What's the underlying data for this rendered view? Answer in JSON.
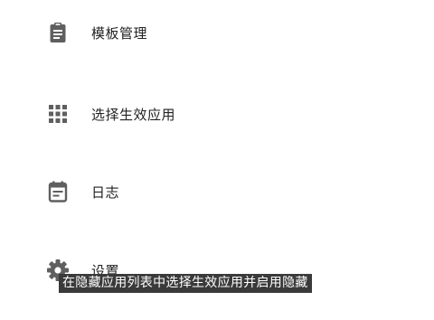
{
  "menu": {
    "items": [
      {
        "label": "模板管理",
        "icon": "clipboard-icon"
      },
      {
        "label": "选择生效应用",
        "icon": "grid-icon"
      },
      {
        "label": "日志",
        "icon": "calendar-icon"
      },
      {
        "label": "设置",
        "icon": "gear-icon"
      }
    ]
  },
  "caption": {
    "text": "在隐藏应用列表中选择生效应用并启用隐藏"
  },
  "colors": {
    "icon": "#5f5f5f",
    "text": "#222222",
    "caption_bg": "#3a3a3a",
    "caption_text": "#ffffff"
  }
}
